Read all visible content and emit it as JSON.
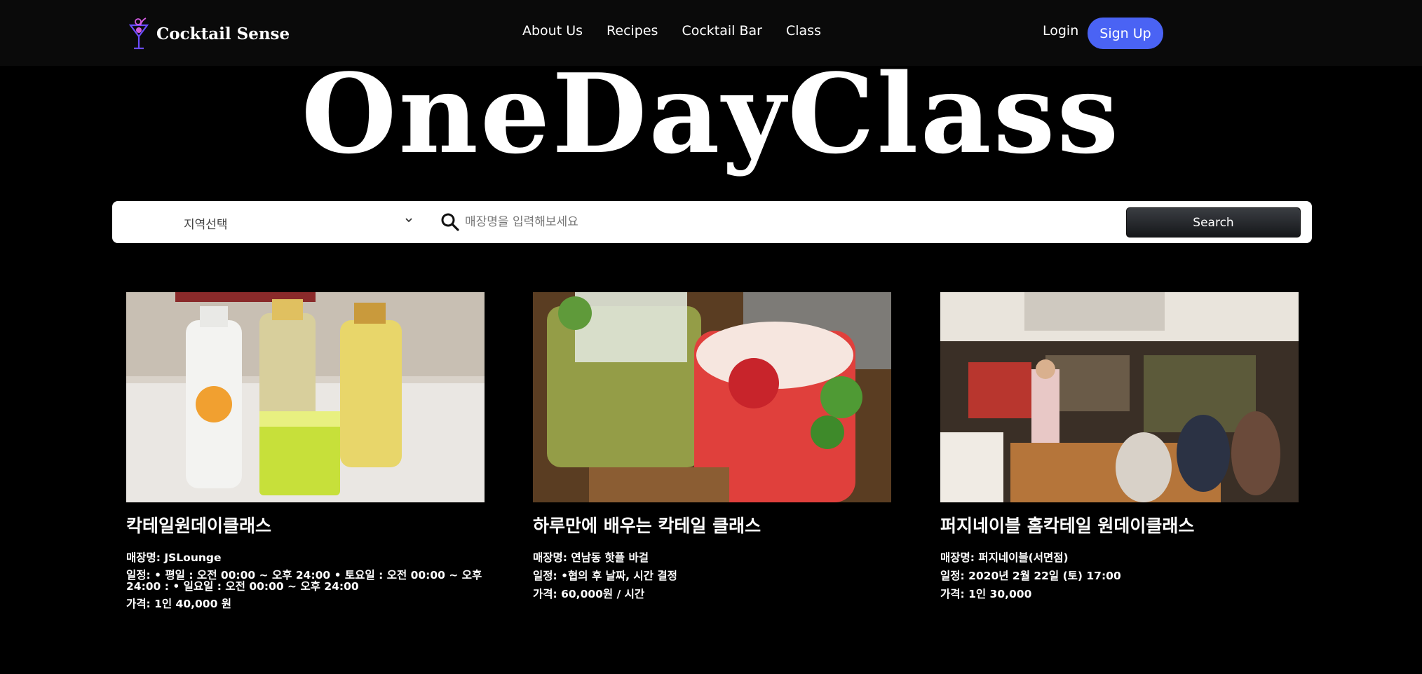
{
  "nav": {
    "brand": "Cocktail Sense",
    "links": [
      "About Us",
      "Recipes",
      "Cocktail Bar",
      "Class"
    ],
    "login": "Login",
    "signup": "Sign Up"
  },
  "hero": {
    "title": "OneDayClass"
  },
  "search": {
    "region_label": "지역선택",
    "placeholder": "매장명을 입력해보세요",
    "button": "Search"
  },
  "classes": [
    {
      "title": "칵테일원데이클래스",
      "store": "매장명: JSLounge",
      "schedule": "일정: • 평일 : 오전 00:00 ~ 오후 24:00 • 토요일 : 오전 00:00 ~ 오후 24:00 : • 일요일 : 오전 00:00 ~ 오후 24:00",
      "price": "가격: 1인 40,000 원"
    },
    {
      "title": "하루만에 배우는 칵테일 클래스",
      "store": "매장명: 연남동 핫플 바걸",
      "schedule": "일정: •협의 후 날짜, 시간 결정",
      "price": "가격: 60,000원 / 시간"
    },
    {
      "title": "퍼지네이블 홈칵테일 원데이클래스",
      "store": "매장명: 퍼지네이블(서면점)",
      "schedule": "일정: 2020년 2월 22일 (토) 17:00",
      "price": "가격: 1인 30,000"
    }
  ]
}
